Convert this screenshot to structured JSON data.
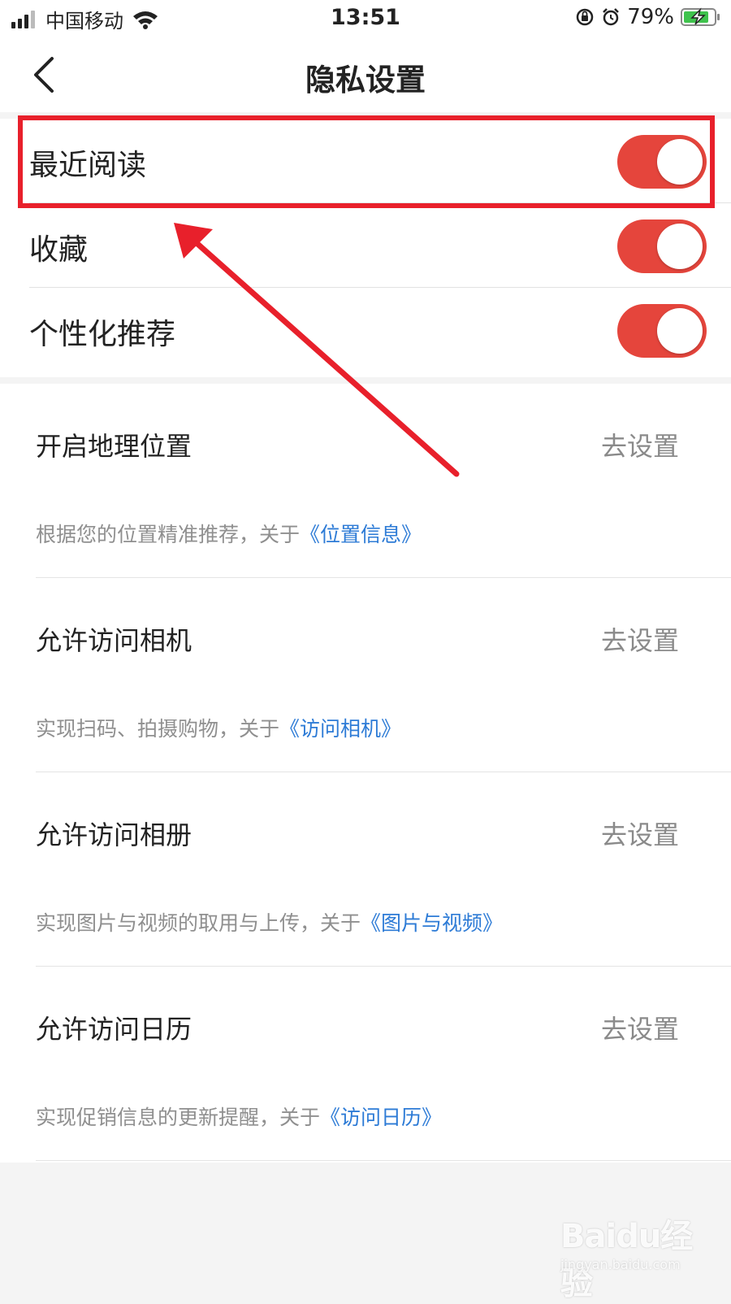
{
  "status_bar": {
    "carrier": "中国移动",
    "time": "13:51",
    "battery_percent": "79%",
    "icons": [
      "signal-icon",
      "wifi-icon",
      "orientation-lock-icon",
      "alarm-icon",
      "battery-charging-icon"
    ]
  },
  "nav": {
    "title": "隐私设置",
    "back_icon": "chevron-left-icon"
  },
  "toggles": [
    {
      "label": "最近阅读",
      "on": true
    },
    {
      "label": "收藏",
      "on": true
    },
    {
      "label": "个性化推荐",
      "on": true
    }
  ],
  "permissions": [
    {
      "title": "开启地理位置",
      "action": "去设置",
      "desc": "根据您的位置精准推荐，关于",
      "link": "《位置信息》"
    },
    {
      "title": "允许访问相机",
      "action": "去设置",
      "desc": "实现扫码、拍摄购物，关于",
      "link": "《访问相机》"
    },
    {
      "title": "允许访问相册",
      "action": "去设置",
      "desc": "实现图片与视频的取用与上传，关于",
      "link": "《图片与视频》"
    },
    {
      "title": "允许访问日历",
      "action": "去设置",
      "desc": "实现促销信息的更新提醒，关于",
      "link": "《访问日历》"
    }
  ],
  "colors": {
    "switch_on": "#e5453c",
    "link": "#2d7bd6",
    "annotation": "#e8202b"
  },
  "watermark": {
    "logo": "Baidu经验",
    "url": "jingyan.baidu.com"
  }
}
